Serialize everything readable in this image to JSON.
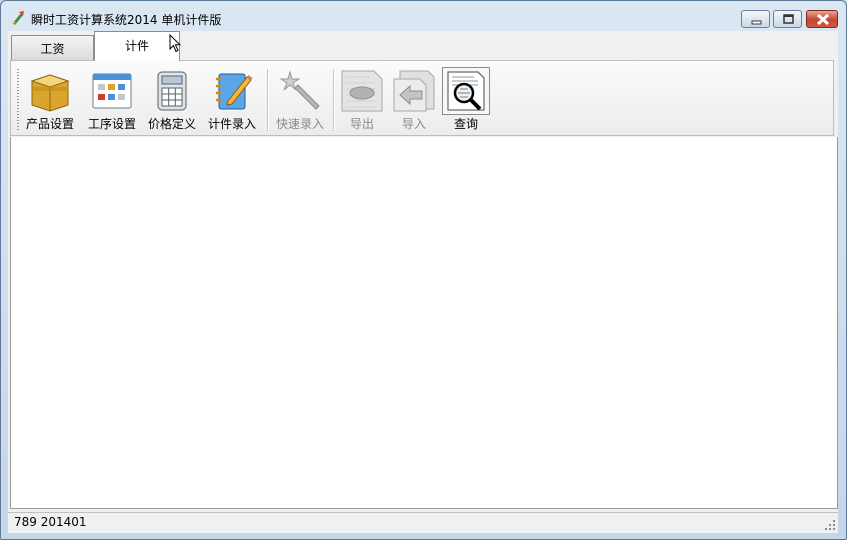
{
  "window": {
    "title": "瞬时工资计算系统2014 单机计件版"
  },
  "tabs": [
    {
      "label": "工资",
      "selected": false
    },
    {
      "label": "计件",
      "selected": true
    }
  ],
  "toolbar": {
    "product": "产品设置",
    "process": "工序设置",
    "price": "价格定义",
    "piece": "计件录入",
    "quick": "快速录入",
    "export": "导出",
    "import": "导入",
    "query": "查询"
  },
  "status": {
    "text": "789 201401"
  },
  "colors": {
    "accent": "#3b8ed8",
    "close": "#c7452f",
    "disabled": "#8a8a8a"
  }
}
